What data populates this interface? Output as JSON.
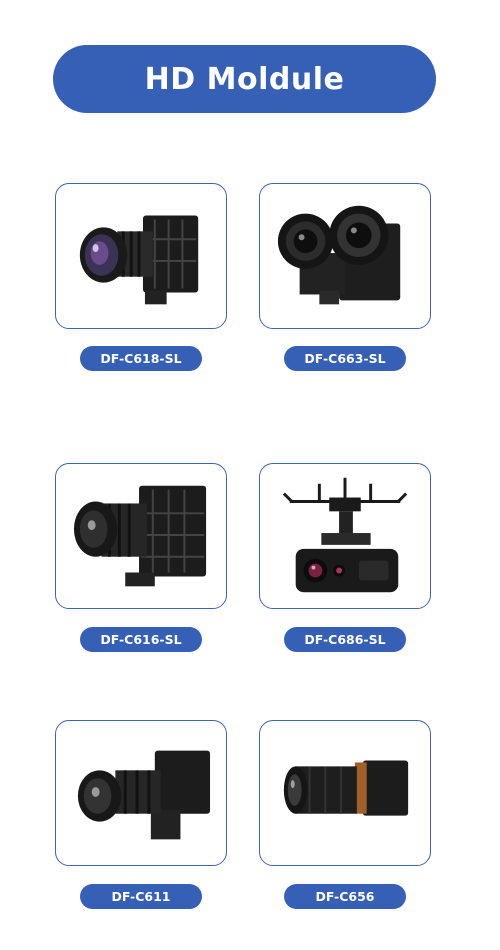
{
  "header": {
    "title": "HD Moldule"
  },
  "products": [
    {
      "label": "DF-C618-SL",
      "image": "camera-module-icon"
    },
    {
      "label": "DF-C663-SL",
      "image": "dual-camera-module-icon"
    },
    {
      "label": "DF-C616-SL",
      "image": "camera-module-icon"
    },
    {
      "label": "DF-C686-SL",
      "image": "gimbal-camera-icon"
    },
    {
      "label": "DF-C611",
      "image": "camera-module-icon"
    },
    {
      "label": "DF-C656",
      "image": "cylinder-camera-icon"
    }
  ],
  "colors": {
    "accent": "#3560b5",
    "border": "#3c63b5",
    "product": "#1c1c1c"
  }
}
